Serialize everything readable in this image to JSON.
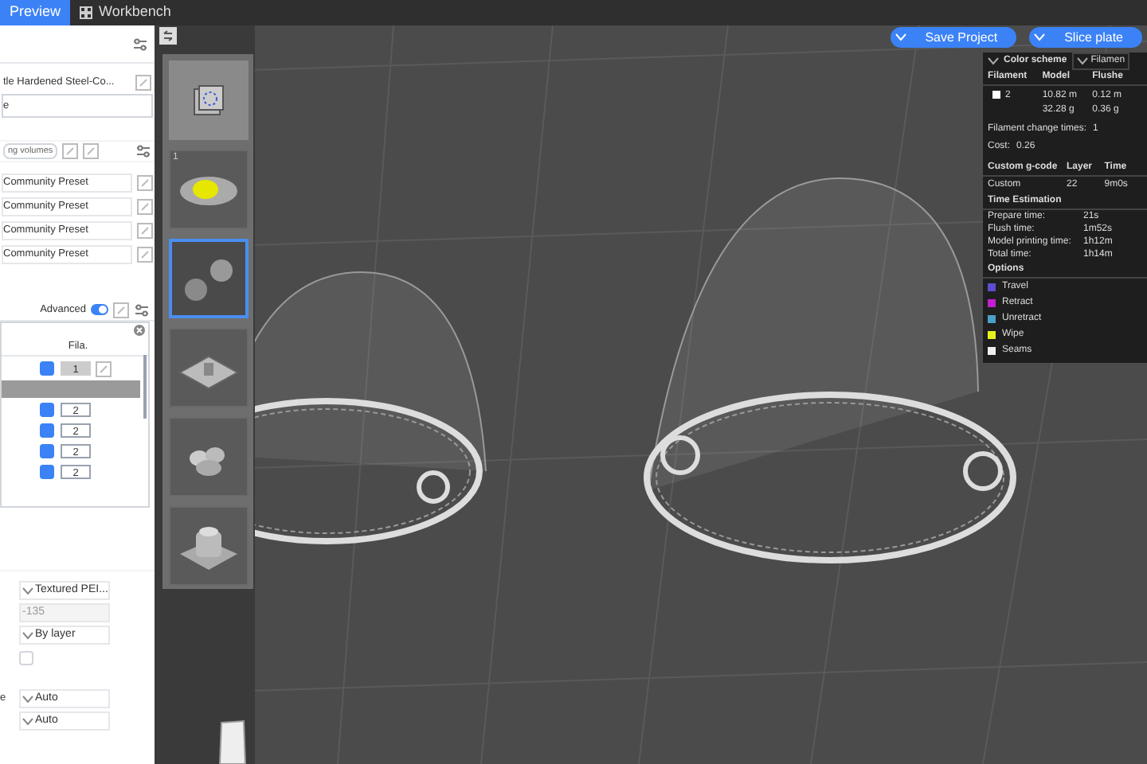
{
  "tabs": [
    {
      "label": "Preview",
      "selected": true
    },
    {
      "label": "Workbench",
      "selected": false
    }
  ],
  "toolbar": {
    "buttons": [
      "Save Project",
      "Slice plate"
    ]
  },
  "left_panel": {
    "filament": "tle Hardened Steel-Co...",
    "notes_text": "e",
    "volumes_button": "ng volumes",
    "presets": [
      "Community Preset",
      "Community Preset",
      "Community Preset",
      "Community Preset"
    ],
    "advanced": {
      "label": "Advanced",
      "on": true
    },
    "table": {
      "columns": [
        "Fila."
      ],
      "rows": [
        {
          "checked": true,
          "value": "1",
          "selected": false,
          "disabled": true
        },
        {
          "selected": true
        },
        {
          "checked": true,
          "value": "2",
          "selected": false,
          "disabled": false
        },
        {
          "checked": true,
          "value": "2",
          "selected": false,
          "disabled": false
        },
        {
          "checked": true,
          "value": "2",
          "selected": false,
          "disabled": false
        },
        {
          "checked": true,
          "value": "2",
          "selected": false,
          "disabled": false
        }
      ]
    },
    "settings": [
      {
        "kind": "dropdown",
        "value": "Textured PEI...",
        "disabled": false
      },
      {
        "kind": "dropdown",
        "value": "-135",
        "disabled": true
      },
      {
        "kind": "dropdown",
        "value": "By layer",
        "disabled": false
      },
      {
        "kind": "checkbox",
        "checked": false
      },
      {
        "kind": "dropdown",
        "label": "e",
        "value": "Auto",
        "disabled": false
      },
      {
        "kind": "dropdown",
        "value": "Auto",
        "disabled": false
      }
    ]
  },
  "thumbnails": [
    {
      "selected": false
    },
    {
      "number": "1",
      "selected": false
    },
    {
      "selected": true
    },
    {
      "selected": false
    },
    {
      "selected": false
    },
    {
      "selected": false
    }
  ],
  "legend": {
    "title": "Color scheme",
    "scheme": "Filamen",
    "columns": [
      "Filament",
      "Model",
      "Flushe"
    ],
    "filament": {
      "name": "2",
      "color": "#ffffff",
      "model": [
        "10.82 m",
        "32.28 g"
      ],
      "flushed": [
        "0.12 m",
        "0.36 g"
      ]
    },
    "change_times": {
      "label": "Filament change times:",
      "value": "1"
    },
    "cost": {
      "label": "Cost:",
      "value": "0.26"
    },
    "gcode_columns": [
      "Custom g-code",
      "Layer",
      "Time"
    ],
    "gcode_row": [
      "Custom",
      "22",
      "9m0s"
    ],
    "time_title": "Time Estimation",
    "times": [
      {
        "label": "Prepare time:",
        "value": "21s"
      },
      {
        "label": "Flush time:",
        "value": "1m52s"
      },
      {
        "label": "Model printing time:",
        "value": "1h12m"
      },
      {
        "label": "Total time:",
        "value": "1h14m"
      }
    ],
    "options_title": "Options",
    "options": [
      {
        "label": "Travel",
        "color": "#5b4fd0"
      },
      {
        "label": "Retract",
        "color": "#c21fd0"
      },
      {
        "label": "Unretract",
        "color": "#4aa0c8"
      },
      {
        "label": "Wipe",
        "color": "#e6f01c"
      },
      {
        "label": "Seams",
        "color": "#eeeeee"
      }
    ]
  }
}
